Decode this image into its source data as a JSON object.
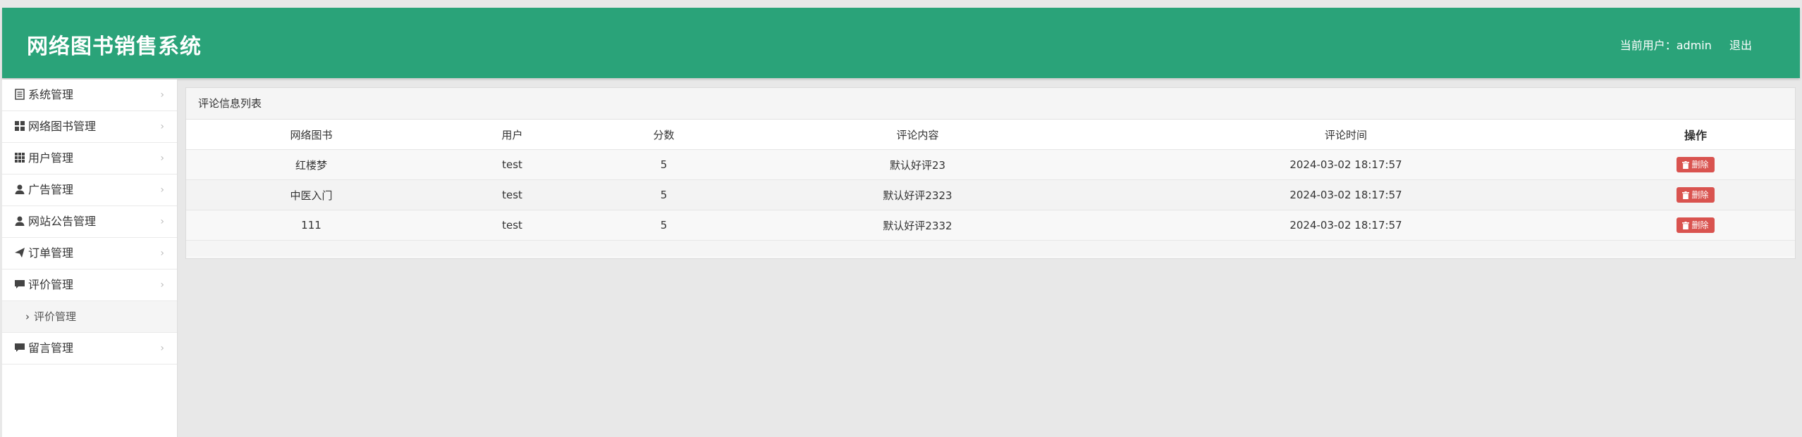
{
  "header": {
    "title": "网络图书销售系统",
    "current_user_label": "当前用户：admin",
    "logout_label": "退出"
  },
  "sidebar": {
    "items": [
      {
        "label": "系统管理",
        "icon": "document-icon"
      },
      {
        "label": "网络图书管理",
        "icon": "grid-large-icon"
      },
      {
        "label": "用户管理",
        "icon": "grid-small-icon"
      },
      {
        "label": "广告管理",
        "icon": "user-icon"
      },
      {
        "label": "网站公告管理",
        "icon": "user-icon"
      },
      {
        "label": "订单管理",
        "icon": "send-icon"
      },
      {
        "label": "评价管理",
        "icon": "comment-icon"
      }
    ],
    "sub_item": {
      "label": "评价管理"
    },
    "last_item": {
      "label": "留言管理",
      "icon": "comment-icon"
    }
  },
  "panel": {
    "title": "评论信息列表",
    "columns": [
      "网络图书",
      "用户",
      "分数",
      "评论内容",
      "评论时间",
      "操作"
    ],
    "rows": [
      {
        "book": "红楼梦",
        "user": "test",
        "score": "5",
        "content": "默认好评23",
        "time": "2024-03-02 18:17:57"
      },
      {
        "book": "中医入门",
        "user": "test",
        "score": "5",
        "content": "默认好评2323",
        "time": "2024-03-02 18:17:57"
      },
      {
        "book": "111",
        "user": "test",
        "score": "5",
        "content": "默认好评2332",
        "time": "2024-03-02 18:17:57"
      }
    ],
    "delete_label": "删除"
  },
  "colors": {
    "header_bg": "#2aa379",
    "delete_btn": "#d9534f"
  }
}
